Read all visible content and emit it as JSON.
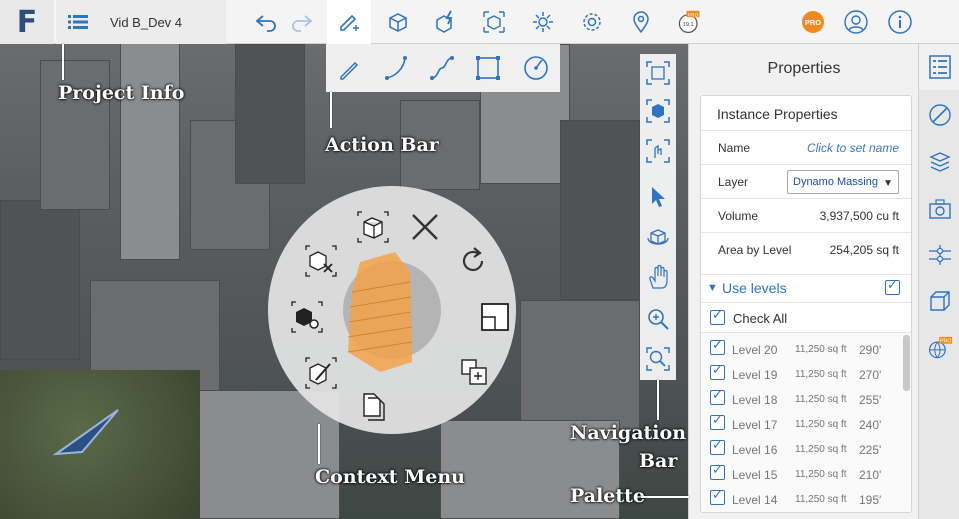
{
  "app": {
    "logo_letter": "F",
    "project_title": "Vid B_Dev 4"
  },
  "toolbar": {
    "buttons": [
      "list-icon",
      "undo-icon",
      "redo-icon",
      "pencil-plus-icon",
      "cube-add-icon",
      "cube-lightning-icon",
      "cube-select-icon",
      "sun-icon",
      "gear-icon",
      "location-pin-icon",
      "version-badge-icon",
      "pro-badge",
      "user-icon",
      "info-icon"
    ],
    "version_text": "19.1",
    "pro_label": "PRO"
  },
  "action_bar": {
    "tools": [
      "pencil-icon",
      "arc-icon",
      "spline-icon",
      "rectangle-icon",
      "circle-icon"
    ]
  },
  "nav_bar": {
    "tools": [
      "zoom-extents-icon",
      "cube-view-icon",
      "fly-icon",
      "select-arrow-icon",
      "orbit-icon",
      "pan-hand-icon",
      "zoom-icon",
      "zoom-window-icon"
    ]
  },
  "properties": {
    "panel_title": "Properties",
    "section_title": "Instance Properties",
    "rows": [
      {
        "key": "Name",
        "value": "Click to set name"
      },
      {
        "key": "Layer",
        "value": "Dynamo Massing"
      },
      {
        "key": "Volume",
        "value": "3,937,500 cu ft"
      },
      {
        "key": "Area by Level",
        "value": "254,205 sq ft"
      }
    ],
    "use_levels_label": "Use levels",
    "check_all_label": "Check All",
    "levels": [
      {
        "name": "Level 20",
        "area": "11,250 sq ft",
        "height": "290'"
      },
      {
        "name": "Level 19",
        "area": "11,250 sq ft",
        "height": "270'"
      },
      {
        "name": "Level 18",
        "area": "11,250 sq ft",
        "height": "255'"
      },
      {
        "name": "Level 17",
        "area": "11,250 sq ft",
        "height": "240'"
      },
      {
        "name": "Level 16",
        "area": "11,250 sq ft",
        "height": "225'"
      },
      {
        "name": "Level 15",
        "area": "11,250 sq ft",
        "height": "210'"
      },
      {
        "name": "Level 14",
        "area": "11,250 sq ft",
        "height": "195'"
      }
    ]
  },
  "side_palette": {
    "tabs": [
      "properties-list-icon",
      "sketch-icon",
      "layers-icon",
      "camera-icon",
      "levels-icon",
      "cube-outline-icon",
      "globe-pro-icon"
    ]
  },
  "context_menu": {
    "items": [
      "cube-group-icon",
      "close-icon",
      "cube-remove-icon",
      "rotate-icon",
      "cube-gear-icon",
      "square-icon",
      "cube-edit-icon",
      "copy-plus-icon",
      "copy-icon"
    ]
  },
  "annotations": {
    "project_info": "Project Info",
    "action_bar": "Action Bar",
    "context_menu": "Context Menu",
    "navigation_bar_1": "Navigation",
    "navigation_bar_2": "Bar",
    "palette": "Palette"
  },
  "colors": {
    "accent_blue": "#2f74c0",
    "pro_orange": "#f08a1c",
    "massing_orange": "#f2a24a"
  }
}
